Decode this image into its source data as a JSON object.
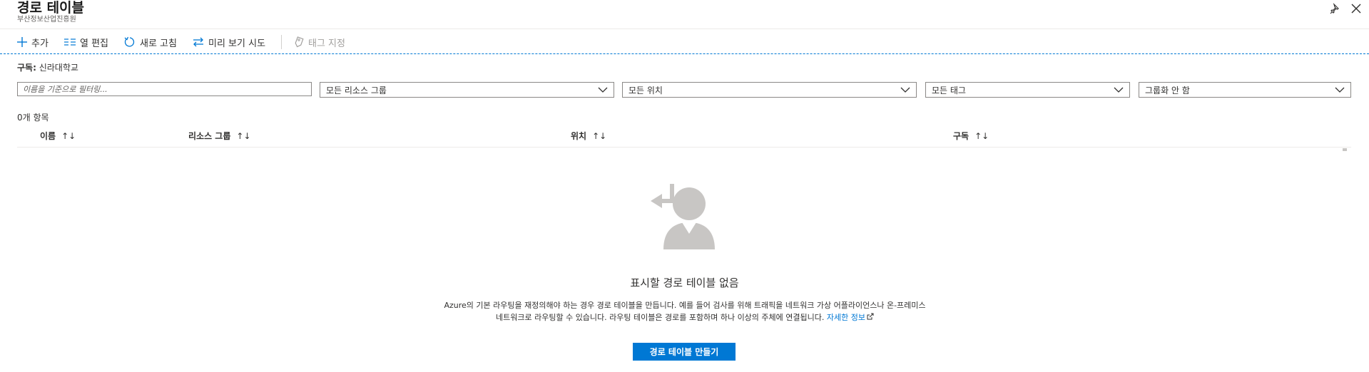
{
  "header": {
    "title": "경로 테이블",
    "subtitle": "부산정보산업진흥원",
    "pin_icon": "pin-icon",
    "close_icon": "close-icon"
  },
  "toolbar": {
    "add_label": "추가",
    "edit_columns_label": "열 편집",
    "refresh_label": "새로 고침",
    "preview_label": "미리 보기 시도",
    "assign_tags_label": "태그 지정"
  },
  "subscription": {
    "label": "구독:",
    "value": "신라대학교"
  },
  "filters": {
    "name_placeholder": "이름을 기준으로 필터링...",
    "resource_group": "모든 리소스 그룹",
    "location": "모든 위치",
    "tags": "모든 태그",
    "grouping": "그룹화 안 함"
  },
  "results": {
    "count_label": "0개 항목"
  },
  "table": {
    "columns": [
      "이름",
      "리소스 그룹",
      "위치",
      "구독"
    ],
    "sort_glyph": "↑↓",
    "rows": []
  },
  "empty_state": {
    "title": "표시할 경로 테이블 없음",
    "description": "Azure의 기본 라우팅을 재정의해야 하는 경우 경로 테이블을 만듭니다. 예를 들어 검사를 위해 트래픽을 네트워크 가상 어플라이언스나 온-프레미스 네트워크로 라우팅할 수 있습니다. 라우팅 테이블은 경로를 포함하며 하나 이상의 주체에 연결됩니다.",
    "learn_more": "자세한 정보",
    "create_button": "경로 테이블 만들기"
  },
  "colors": {
    "accent": "#0078d4",
    "empty_illustration": "#c8c6c4"
  }
}
